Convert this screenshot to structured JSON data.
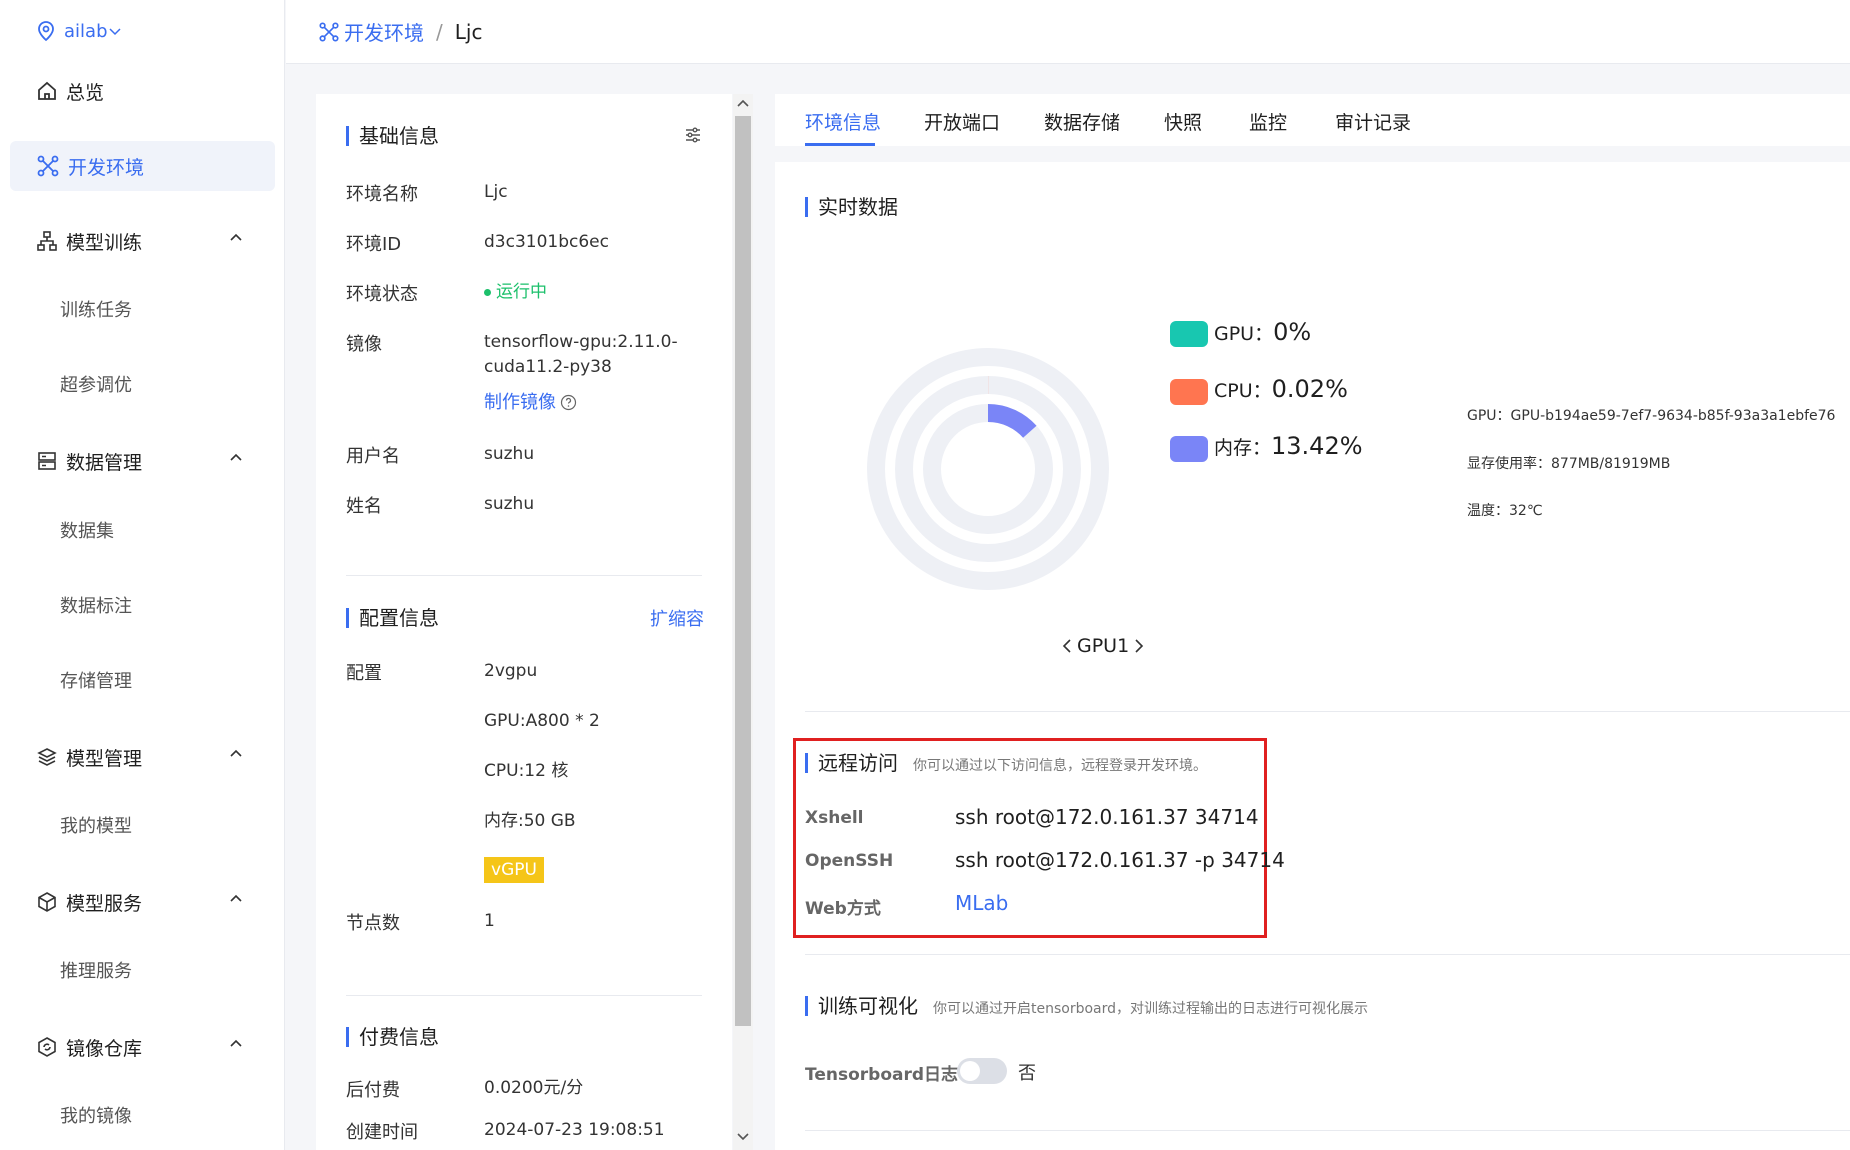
{
  "sidebar": {
    "workspace": "ailab",
    "items": [
      {
        "label": "总览"
      },
      {
        "label": "开发环境"
      },
      {
        "label": "模型训练",
        "sub": [
          "训练任务",
          "超参调优"
        ]
      },
      {
        "label": "数据管理",
        "sub": [
          "数据集",
          "数据标注",
          "存储管理"
        ]
      },
      {
        "label": "模型管理",
        "sub": [
          "我的模型"
        ]
      },
      {
        "label": "模型服务",
        "sub": [
          "推理服务"
        ]
      },
      {
        "label": "镜像仓库",
        "sub": [
          "我的镜像"
        ]
      }
    ]
  },
  "breadcrumb": {
    "parent": "开发环境",
    "separator": "/",
    "current": "Ljc"
  },
  "basic": {
    "title": "基础信息",
    "rows": [
      {
        "label": "环境名称",
        "value": "Ljc"
      },
      {
        "label": "环境ID",
        "value": "d3c3101bc6ec"
      },
      {
        "label": "环境状态",
        "value": "运行中"
      },
      {
        "label": "镜像",
        "value": "tensorflow-gpu:2.11.0-cuda11.2-py38"
      },
      {
        "label": "用户名",
        "value": "suzhu"
      },
      {
        "label": "姓名",
        "value": "suzhu"
      }
    ],
    "make_image": "制作镜像",
    "status_color": "#1cc06b"
  },
  "config": {
    "title": "配置信息",
    "expand": "扩缩容",
    "label_config": "配置",
    "values": [
      "2vgpu",
      "GPU:A800 * 2",
      "CPU:12 核",
      "内存:50 GB"
    ],
    "badge": "vGPU",
    "badge_color": "#f5c518",
    "label_nodes": "节点数",
    "nodes": "1"
  },
  "billing": {
    "title": "付费信息",
    "rows": [
      {
        "label": "后付费",
        "value": "0.0200元/分"
      },
      {
        "label": "创建时间",
        "value": "2024-07-23 19:08:51"
      }
    ]
  },
  "tabs": [
    "环境信息",
    "开放端口",
    "数据存储",
    "快照",
    "监控",
    "审计记录"
  ],
  "realtime": {
    "title": "实时数据",
    "legend": [
      {
        "label": "GPU：",
        "value": "0%",
        "color": "#18c7b0"
      },
      {
        "label": "CPU：",
        "value": "0.02%",
        "color": "#ff7550"
      },
      {
        "label": "内存：",
        "value": "13.42%",
        "color": "#7a85f7"
      }
    ],
    "gpu_info": [
      "GPU：GPU-b194ae59-7ef7-9634-b85f-93a3a1ebfe76",
      "显存使用率：877MB/81919MB",
      "温度：32℃"
    ],
    "gpu_nav": "GPU1",
    "rings": {
      "gpu": 0,
      "cpu": 0.02,
      "memory": 13.42
    }
  },
  "remote": {
    "title": "远程访问",
    "hint": "你可以通过以下访问信息，远程登录开发环境。",
    "rows": [
      {
        "label": "Xshell",
        "value": "ssh root@172.0.161.37 34714"
      },
      {
        "label": "OpenSSH",
        "value": "ssh root@172.0.161.37 -p 34714"
      },
      {
        "label": "Web方式",
        "value": "MLab"
      }
    ]
  },
  "viz": {
    "title": "训练可视化",
    "hint": "你可以通过开启tensorboard，对训练过程输出的日志进行可视化展示",
    "toggle_label": "Tensorboard日志",
    "toggle_state": "否"
  }
}
